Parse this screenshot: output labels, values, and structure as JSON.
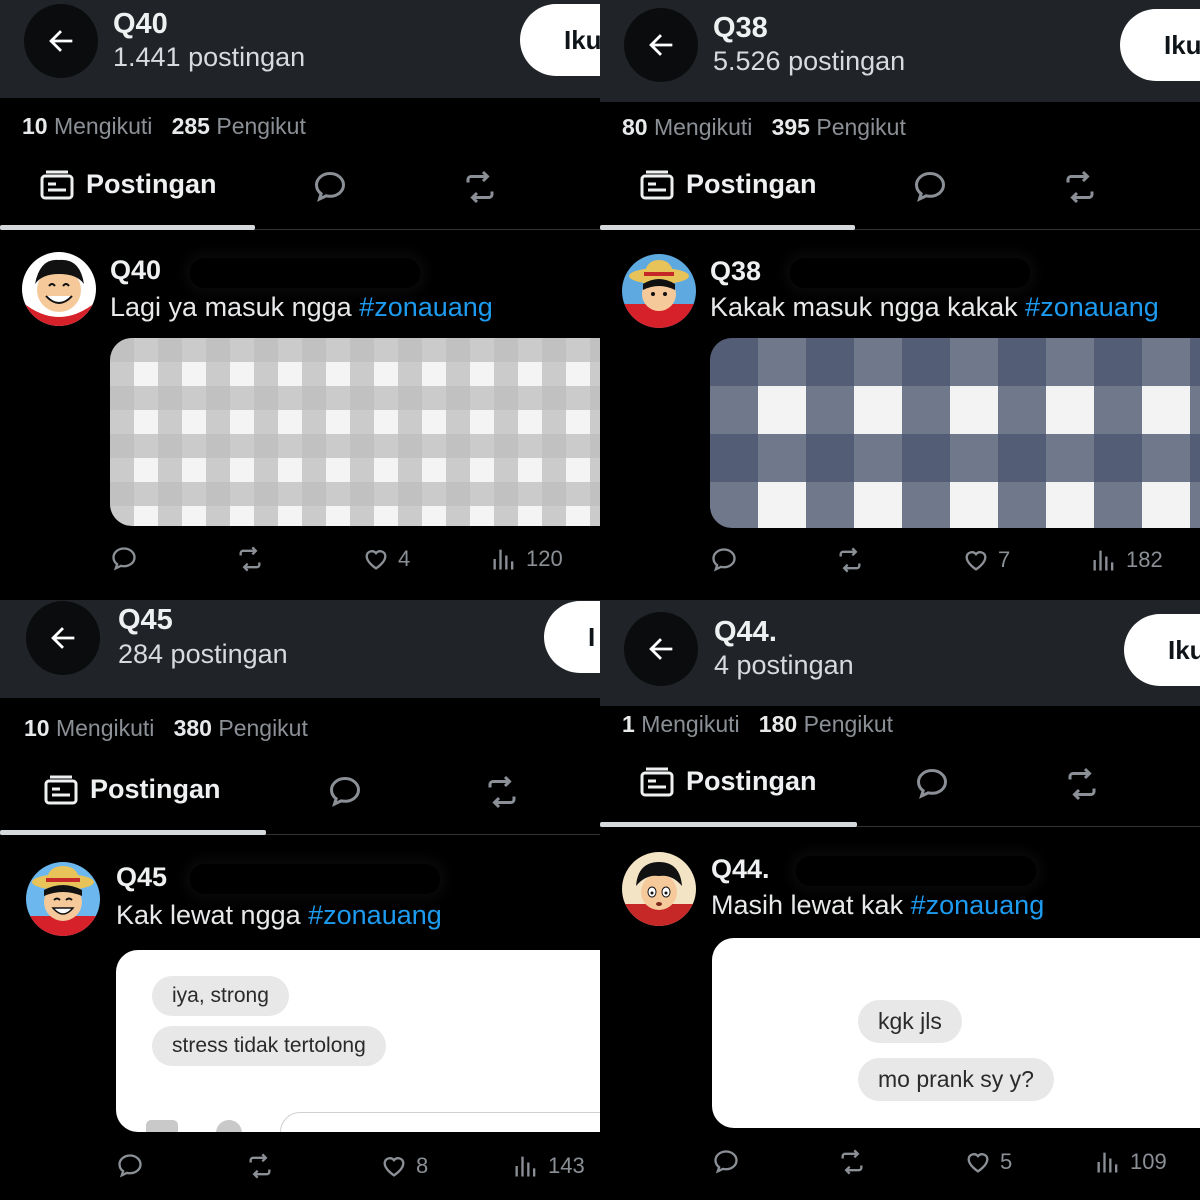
{
  "colors": {
    "header_bg": "#202327",
    "accent": "#1d9bf0",
    "muted": "#8b9096",
    "follow_bg": "#ffffff"
  },
  "icons": {
    "back": "arrow-left-icon",
    "posts_tab": "posts-tab-icon",
    "replies_tab": "speech-bubble-icon",
    "reposts_tab": "repost-icon",
    "reply": "reply-icon",
    "repost": "repost-icon",
    "like": "heart-icon",
    "views": "bar-chart-icon"
  },
  "panels": [
    {
      "header": {
        "name": "Q40",
        "post_count": "1.441 postingan",
        "follow_label": "Iku"
      },
      "stats": {
        "following": "10",
        "following_label": "Mengikuti",
        "followers": "285",
        "followers_label": "Pengikut"
      },
      "tabs": {
        "posts_label": "Postingan"
      },
      "post": {
        "author": "Q40",
        "text": "Lagi ya masuk ngga ",
        "hashtag": "#zonauang",
        "media": "gray-gingham-fabric",
        "replies": "",
        "reposts": "",
        "likes": "4",
        "views": "120"
      }
    },
    {
      "header": {
        "name": "Q38",
        "post_count": "5.526 postingan",
        "follow_label": "Iku"
      },
      "stats": {
        "following": "80",
        "following_label": "Mengikuti",
        "followers": "395",
        "followers_label": "Pengikut"
      },
      "tabs": {
        "posts_label": "Postingan"
      },
      "post": {
        "author": "Q38",
        "text": "Kakak masuk ngga kakak ",
        "hashtag": "#zonauang",
        "media": "navy-gingham-fabric",
        "replies": "",
        "reposts": "",
        "likes": "7",
        "views": "182"
      }
    },
    {
      "header": {
        "name": "Q45",
        "post_count": "284 postingan",
        "follow_label": "I"
      },
      "stats": {
        "following": "10",
        "following_label": "Mengikuti",
        "followers": "380",
        "followers_label": "Pengikut"
      },
      "tabs": {
        "posts_label": "Postingan"
      },
      "post": {
        "author": "Q45",
        "text": "Kak lewat ngga ",
        "hashtag": "#zonauang",
        "media": "chat-screenshot",
        "chat": [
          "iya, strong",
          "stress tidak tertolong"
        ],
        "replies": "",
        "reposts": "",
        "likes": "8",
        "views": "143"
      }
    },
    {
      "header": {
        "name": "Q44.",
        "post_count": "4 postingan",
        "follow_label": "Iku"
      },
      "stats": {
        "following": "1",
        "following_label": "Mengikuti",
        "followers": "180",
        "followers_label": "Pengikut"
      },
      "tabs": {
        "posts_label": "Postingan"
      },
      "post": {
        "author": "Q44.",
        "text": "Masih lewat kak ",
        "hashtag": "#zonauang",
        "media": "chat-screenshot",
        "chat": [
          "kgk jls",
          "mo prank sy y?"
        ],
        "replies": "",
        "reposts": "",
        "likes": "5",
        "views": "109"
      }
    }
  ]
}
